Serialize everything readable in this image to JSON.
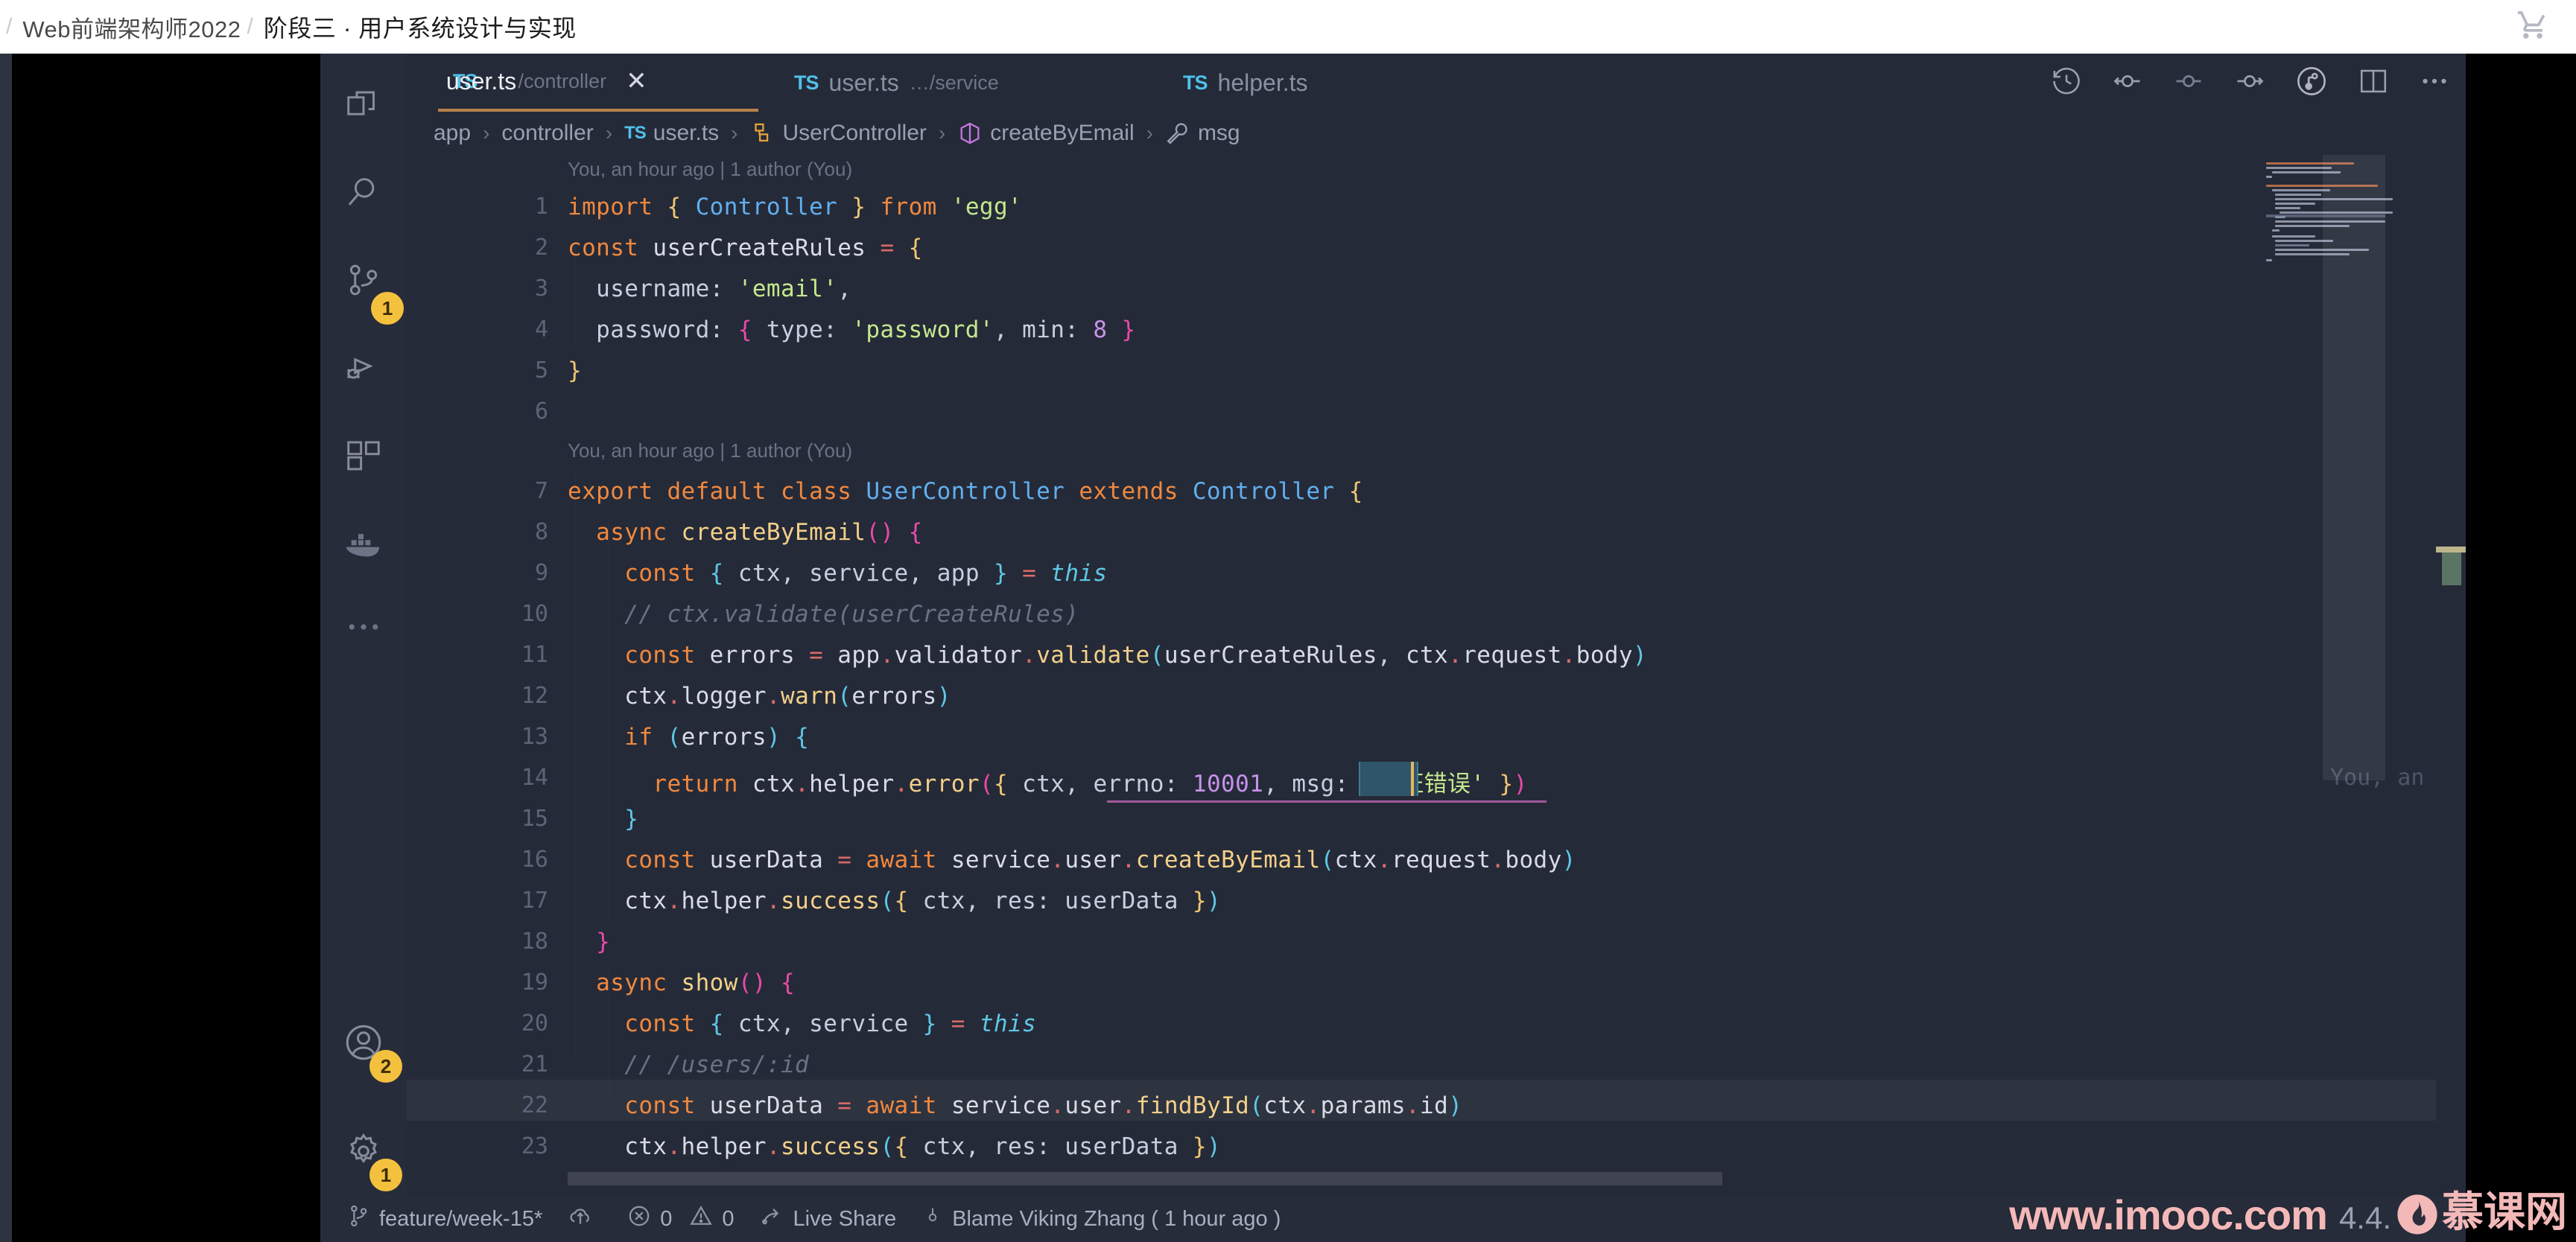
{
  "coursebar": {
    "crumb_sep": "/",
    "course": "Web前端架构师2022",
    "chapter": "阶段三 · 用户系统设计与实现",
    "cart_icon": "shopping-cart-icon"
  },
  "activitybar": {
    "items": [
      {
        "name": "explorer",
        "icon": "files-icon",
        "badge": null
      },
      {
        "name": "search",
        "icon": "search-icon",
        "badge": null
      },
      {
        "name": "source-control",
        "icon": "source-control-icon",
        "badge": "1"
      },
      {
        "name": "run-debug",
        "icon": "run-debug-icon",
        "badge": null
      },
      {
        "name": "extensions",
        "icon": "extensions-icon",
        "badge": null
      },
      {
        "name": "docker",
        "icon": "docker-icon",
        "badge": null
      },
      {
        "name": "more-views",
        "icon": "ellipsis-icon",
        "badge": null
      }
    ],
    "bottom": [
      {
        "name": "accounts",
        "icon": "account-icon",
        "badge": "2"
      },
      {
        "name": "manage",
        "icon": "gear-icon",
        "badge": "1"
      }
    ]
  },
  "tabs": [
    {
      "ts": "TS",
      "name": "user.ts",
      "path": "…/controller",
      "active": true,
      "close": "✕"
    },
    {
      "ts": "TS",
      "name": "user.ts",
      "path": "…/service",
      "active": false,
      "close": ""
    },
    {
      "ts": "TS",
      "name": "helper.ts",
      "path": "",
      "active": false,
      "close": ""
    }
  ],
  "editor_actions": [
    {
      "name": "timeline-history-icon"
    },
    {
      "name": "previous-change-icon"
    },
    {
      "name": "current-change-icon"
    },
    {
      "name": "next-change-icon"
    },
    {
      "name": "git-graph-icon"
    },
    {
      "name": "split-editor-icon"
    },
    {
      "name": "more-actions-icon"
    }
  ],
  "breadcrumb": {
    "separator": "›",
    "items": [
      {
        "label": "app",
        "icon": null
      },
      {
        "label": "controller",
        "icon": null
      },
      {
        "label": "user.ts",
        "icon": "typescript-icon",
        "icon_text": "TS"
      },
      {
        "label": "UserController",
        "icon": "class-icon"
      },
      {
        "label": "createByEmail",
        "icon": "method-icon"
      },
      {
        "label": "msg",
        "icon": "property-icon"
      }
    ]
  },
  "code": {
    "blame_header_1": "You, an hour ago | 1 author (You)",
    "blame_header_2": "You, an hour ago | 1 author (You)",
    "blame_inline_line14": "You, an hour a",
    "line_numbers": [
      "1",
      "2",
      "3",
      "4",
      "5",
      "6",
      "7",
      "8",
      "9",
      "10",
      "11",
      "12",
      "13",
      "14",
      "15",
      "16",
      "17",
      "18",
      "19",
      "20",
      "21",
      "22",
      "23"
    ],
    "lines": [
      "import { Controller } from 'egg'",
      "const userCreateRules = {",
      "  username: 'email',",
      "  password: { type: 'password', min: 8 }",
      "}",
      "",
      "export default class UserController extends Controller {",
      "  async createByEmail() {",
      "    const { ctx, service, app } = this",
      "    // ctx.validate(userCreateRules)",
      "    const errors = app.validator.validate(userCreateRules, ctx.request.body)",
      "    ctx.logger.warn(errors)",
      "    if (errors) {",
      "      return ctx.helper.error({ ctx, errno: 10001, msg: '验证错误' })",
      "    }",
      "    const userData = await service.user.createByEmail(ctx.request.body)",
      "    ctx.helper.success({ ctx, res: userData })",
      "  }",
      "  async show() {",
      "    const { ctx, service } = this",
      "    // /users/:id",
      "    const userData = await service.user.findById(ctx.params.id)",
      "    ctx.helper.success({ ctx, res: userData })"
    ],
    "selection_word": "msg"
  },
  "statusbar": {
    "branch": "feature/week-15*",
    "branch_icon": "source-control-branch-icon",
    "sync_icon": "sync-cloud-icon",
    "errors_icon": "error-circle-icon",
    "errors": "0",
    "warnings_icon": "warning-triangle-icon",
    "warnings": "0",
    "live_share_icon": "live-share-icon",
    "live_share": "Live Share",
    "blame_icon": "git-commit-icon",
    "blame": "Blame Viking Zhang ( 1 hour ago )"
  },
  "watermark": {
    "url": "www.imooc.com",
    "version": "4.4.",
    "brand": "慕课网",
    "logo": "imooc-flame-logo"
  },
  "colors": {
    "editor_bg": "#252a38",
    "activity_bg": "#272c3a",
    "accent_tab": "#b5814a",
    "badge": "#f4c13e",
    "keyword": "#f0883e",
    "string": "#c3e88d",
    "number": "#c792ea",
    "class": "#61afef",
    "function": "#f3d08a",
    "comment": "#6a7186",
    "watermark": "#f3b8b8"
  }
}
